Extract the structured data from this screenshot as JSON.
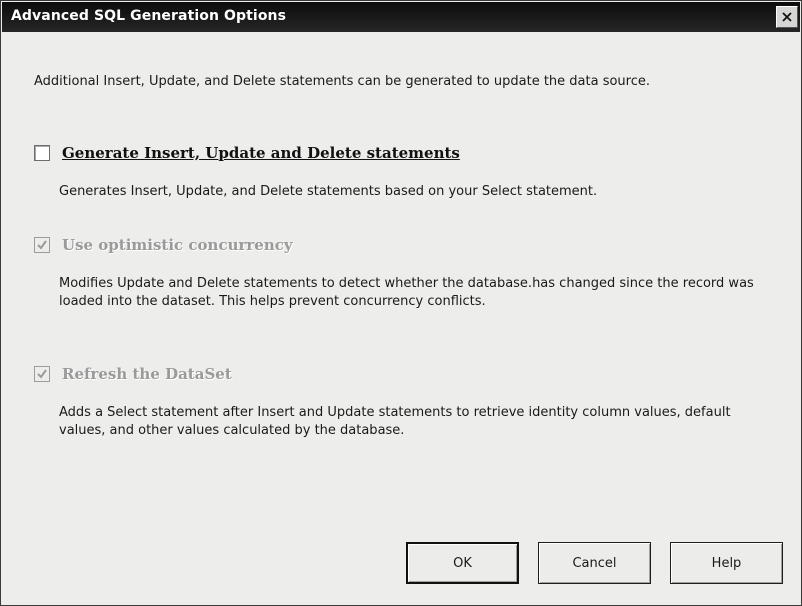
{
  "dialog": {
    "title": "Advanced SQL Generation Options",
    "close_symbol": "×",
    "description": "Additional Insert, Update, and Delete statements can be generated to update the data source."
  },
  "options": [
    {
      "label": "Generate Insert, Update and Delete statements",
      "checked": false,
      "enabled": true,
      "description": "Generates Insert, Update, and Delete statements based on your Select statement."
    },
    {
      "label": "Use optimistic concurrency",
      "checked": true,
      "enabled": false,
      "description": "Modifies Update and Delete statements to detect whether the database.has changed since the record was loaded into the dataset. This helps prevent concurrency conflicts."
    },
    {
      "label": "Refresh the DataSet",
      "checked": true,
      "enabled": false,
      "description": "Adds a Select statement after Insert and Update statements to retrieve identity column values, default values, and other values calculated by the database."
    }
  ],
  "buttons": {
    "ok": "OK",
    "cancel": "Cancel",
    "help": "Help"
  },
  "icons": {
    "close": "close-icon",
    "checkmark": "checkmark-icon"
  },
  "colors": {
    "titlebar": "#111111",
    "dialog_bg": "#ededeb",
    "disabled_text": "#9a9a9a"
  }
}
